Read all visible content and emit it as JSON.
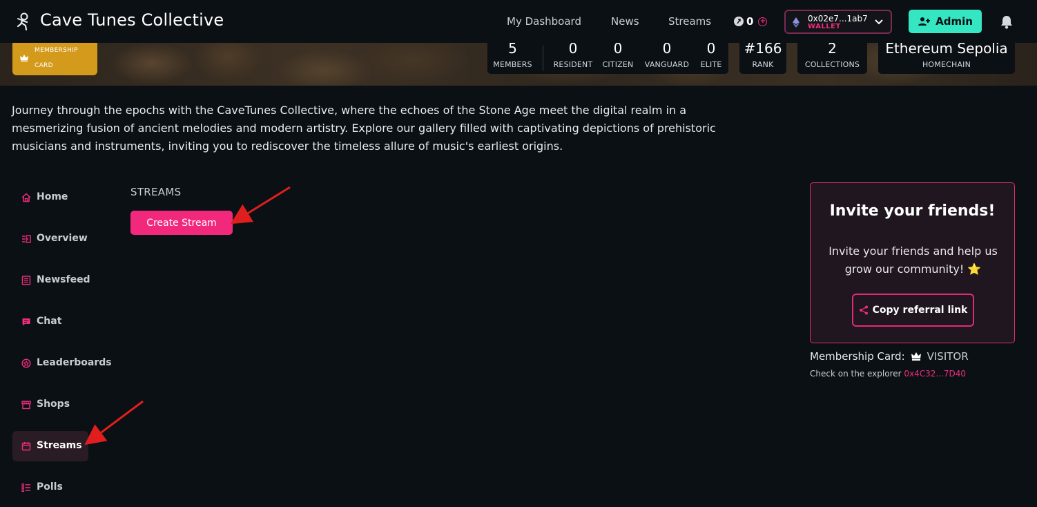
{
  "header": {
    "app_title": "Cave Tunes Collective",
    "nav": [
      "My Dashboard",
      "News",
      "Streams"
    ],
    "points": "0",
    "wallet_address": "0x02e7...1ab7",
    "wallet_label": "WALLET",
    "admin_label": "Admin"
  },
  "banner": {
    "membership_card": [
      "MEMBERSHIP",
      "CARD"
    ],
    "members": {
      "value": "5",
      "label": "MEMBERS"
    },
    "tiers": [
      {
        "value": "0",
        "label": "RESIDENT"
      },
      {
        "value": "0",
        "label": "CITIZEN"
      },
      {
        "value": "0",
        "label": "VANGUARD"
      },
      {
        "value": "0",
        "label": "ELITE"
      }
    ],
    "rank": {
      "value": "#166",
      "label": "RANK"
    },
    "collections": {
      "value": "2",
      "label": "COLLECTIONS"
    },
    "homechain": {
      "value": "Ethereum Sepolia",
      "label": "HOMECHAIN"
    }
  },
  "description": "Journey through the epochs with the CaveTunes Collective, where the echoes of the Stone Age meet the digital realm in a mesmerizing fusion of ancient melodies and modern artistry. Explore our gallery filled with captivating depictions of prehistoric musicians and instruments, inviting you to rediscover the timeless allure of music's earliest origins.",
  "sidebar": {
    "items": [
      {
        "label": "Home",
        "icon": "home-icon"
      },
      {
        "label": "Overview",
        "icon": "overview-icon"
      },
      {
        "label": "Newsfeed",
        "icon": "newsfeed-icon"
      },
      {
        "label": "Chat",
        "icon": "chat-icon"
      },
      {
        "label": "Leaderboards",
        "icon": "leaderboard-icon"
      },
      {
        "label": "Shops",
        "icon": "shop-icon"
      },
      {
        "label": "Streams",
        "icon": "calendar-icon",
        "active": true
      },
      {
        "label": "Polls",
        "icon": "polls-icon"
      }
    ]
  },
  "main": {
    "heading": "STREAMS",
    "create_button": "Create Stream"
  },
  "invite": {
    "title": "Invite your friends!",
    "text": "Invite your friends and help us grow our community! ⭐",
    "button": "Copy referral link",
    "membership_label": "Membership Card:",
    "membership_value": "VISITOR",
    "explorer_text": "Check on the explorer",
    "explorer_link": "0x4C32...7D40"
  },
  "colors": {
    "accent": "#f2287d",
    "admin": "#35e6c3",
    "card_gold": "#d49a1c",
    "background": "#0b1015"
  }
}
